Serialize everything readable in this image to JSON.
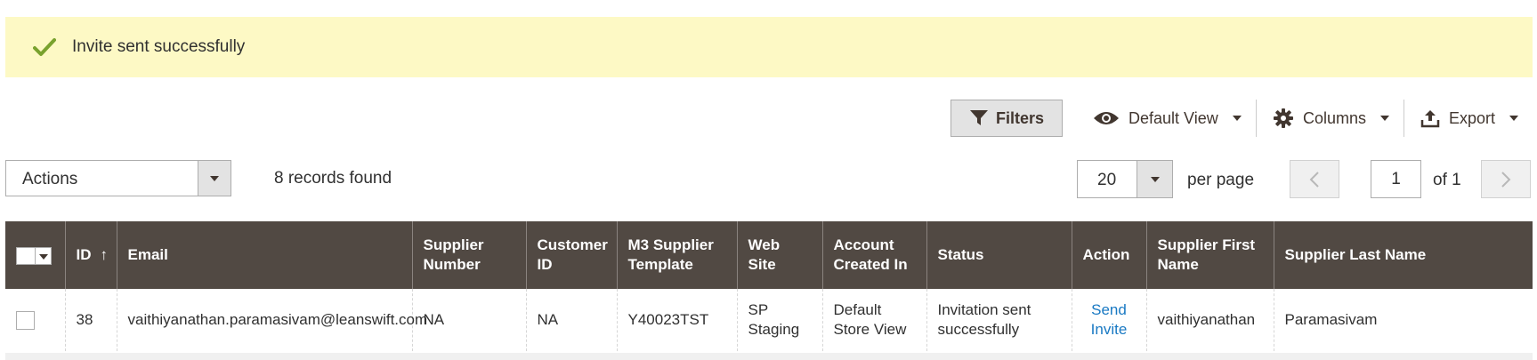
{
  "message": {
    "text": "Invite sent successfully"
  },
  "toolbar": {
    "filters_label": "Filters",
    "view_label": "Default View",
    "columns_label": "Columns",
    "export_label": "Export"
  },
  "mass_actions": {
    "label": "Actions"
  },
  "records_found": "8 records found",
  "pagination": {
    "per_page_value": "20",
    "per_page_label": "per page",
    "current_page": "1",
    "of_label": "of 1"
  },
  "grid": {
    "columns": {
      "id": "ID",
      "email": "Email",
      "supplier_number": "Supplier Number",
      "customer_id": "Customer ID",
      "m3_template": "M3 Supplier Template",
      "website": "Web Site",
      "account_created_in": "Account Created In",
      "status": "Status",
      "action": "Action",
      "first_name": "Supplier First Name",
      "last_name": "Supplier Last Name"
    },
    "sort_arrow": "↑",
    "rows": [
      {
        "id": "38",
        "email": "vaithiyanathan.paramasivam@leanswift.com",
        "supplier_number": "NA",
        "customer_id": "NA",
        "m3_template": "Y40023TST",
        "website": "SP Staging",
        "account_created_in": "Default Store View",
        "status": "Invitation sent successfully",
        "action": "Send Invite",
        "first_name": "vaithiyanathan",
        "last_name": "Paramasivam"
      }
    ]
  },
  "colors": {
    "header_bg": "#514943",
    "message_bg": "#fdf9c5",
    "link": "#1979c3",
    "success": "#79a22e"
  }
}
